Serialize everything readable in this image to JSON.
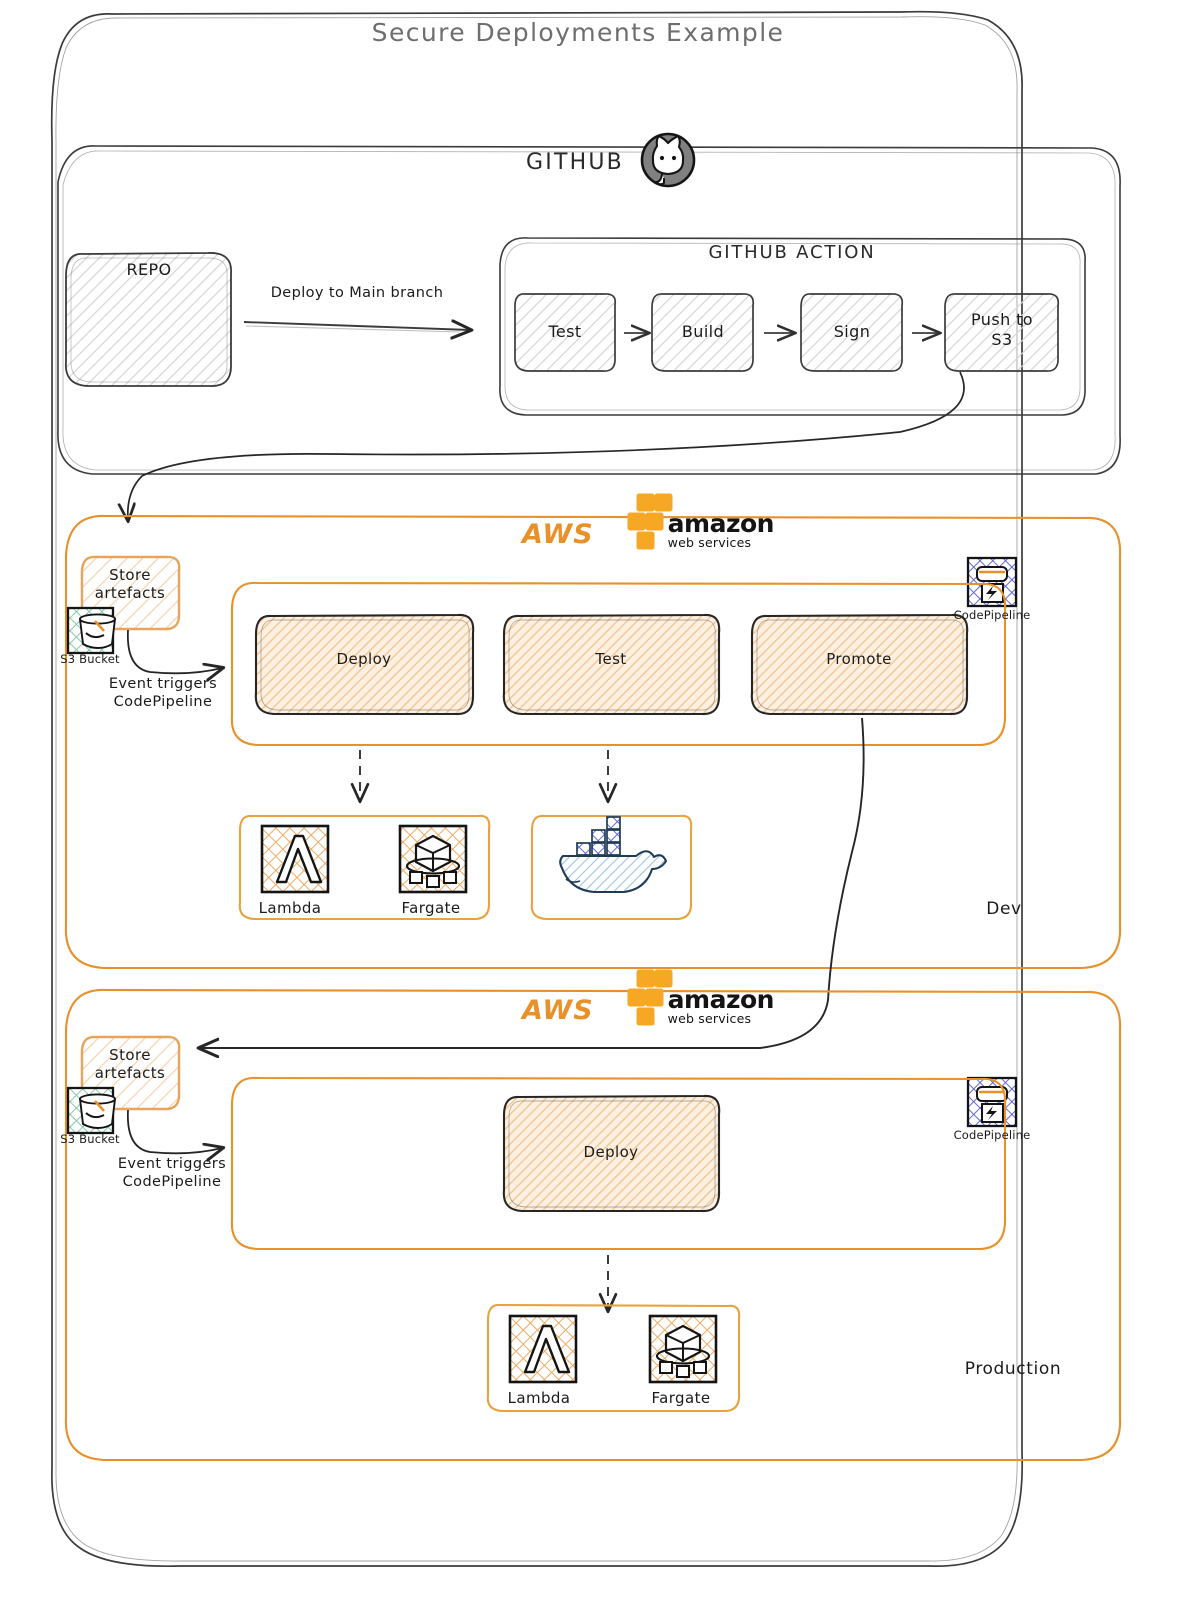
{
  "diagram": {
    "title": "Secure Deployments Example",
    "github": {
      "label": "GITHUB",
      "icon": "github-octocat-icon",
      "repo": {
        "label": "REPO"
      },
      "edge_repo_to_action": "Deploy to Main branch",
      "action": {
        "label": "GITHUB ACTION",
        "steps": [
          {
            "label": "Test"
          },
          {
            "label": "Build"
          },
          {
            "label": "Sign"
          },
          {
            "label": "Push to\nS3"
          }
        ]
      }
    },
    "aws_logo": {
      "aws": "AWS",
      "amazon": "amazon",
      "web_services": "web services"
    },
    "environments": [
      {
        "name": "Dev",
        "store": {
          "label": "Store\nartefacts"
        },
        "s3_caption": "S3 Bucket",
        "codepipeline_caption": "CodePipeline",
        "event_text": "Event triggers\nCodePipeline",
        "stages": [
          {
            "label": "Deploy"
          },
          {
            "label": "Test"
          },
          {
            "label": "Promote"
          }
        ],
        "targets": [
          {
            "label": "Lambda",
            "icon": "aws-lambda-icon"
          },
          {
            "label": "Fargate",
            "icon": "aws-fargate-icon"
          }
        ],
        "docker": {
          "icon": "docker-whale-icon"
        }
      },
      {
        "name": "Production",
        "store": {
          "label": "Store\nartefacts"
        },
        "s3_caption": "S3 Bucket",
        "codepipeline_caption": "CodePipeline",
        "event_text": "Event triggers\nCodePipeline",
        "stages": [
          {
            "label": "Deploy"
          }
        ],
        "targets": [
          {
            "label": "Lambda",
            "icon": "aws-lambda-icon"
          },
          {
            "label": "Fargate",
            "icon": "aws-fargate-icon"
          }
        ]
      }
    ],
    "colors": {
      "aws_orange": "#e8912a",
      "stage_fill": "#fbe2c4",
      "grey_stroke": "#3b3b3b",
      "title_grey": "#6e6e6e",
      "s3_green": "#4ba37f",
      "codepipeline_blue": "#4a50c8"
    }
  }
}
